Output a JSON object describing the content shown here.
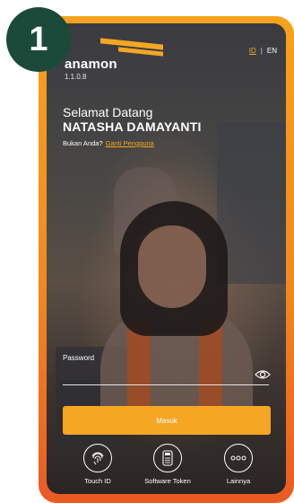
{
  "step_badge": "1",
  "header": {
    "logo_text": "anamon",
    "version": "1.1.0.8",
    "lang_id": "ID",
    "lang_sep": "|",
    "lang_en": "EN"
  },
  "welcome": {
    "greeting": "Selamat Datang",
    "name": "NATASHA DAMAYANTI",
    "not_you": "Bukan Anda?",
    "change_user": "Ganti Pengguna"
  },
  "login": {
    "password_label": "Password",
    "password_value": "",
    "button_label": "Masuk"
  },
  "quick_actions": [
    {
      "label": "Touch ID",
      "icon": "fingerprint-icon"
    },
    {
      "label": "Software Token",
      "icon": "token-device-icon"
    },
    {
      "label": "Lainnya",
      "icon": "more-dots-icon"
    }
  ],
  "colors": {
    "accent": "#f5a623",
    "frame_top": "#f7a21c",
    "frame_bottom": "#ea5a23",
    "badge": "#1b4a3a"
  }
}
